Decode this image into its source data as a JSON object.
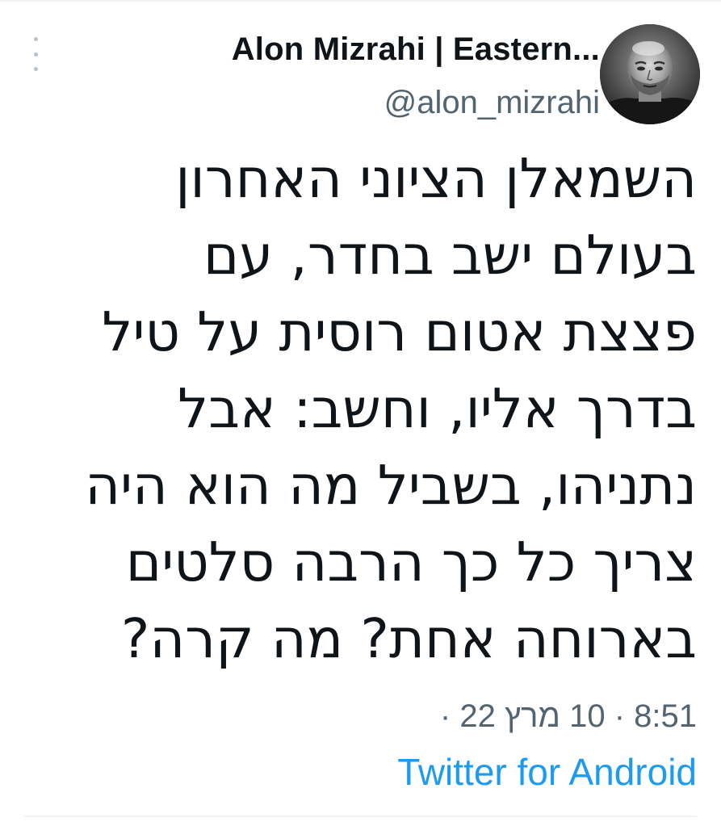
{
  "tweet": {
    "author": {
      "display_name": "Alon Mizrahi | Eastern...",
      "handle": "@alon_mizrahi",
      "avatar_icon": "profile-photo"
    },
    "text_lines": [
      "השמאלן הציוני האחרון",
      "בעולם ישב בחדר, עם",
      "פצצת אטום רוסית על טיל",
      "בדרך אליו, וחשב: אבל",
      "נתניהו, בשביל מה הוא היה",
      "צריך כל כך הרבה סלטים",
      "בארוחה אחת? מה קרה?"
    ],
    "timestamp": "8:51 · 10 מרץ 22 ·",
    "source": "Twitter for Android"
  },
  "colors": {
    "text_primary": "#0f1419",
    "text_secondary": "#536471",
    "link": "#1d9bf0",
    "divider": "#eff3f4"
  }
}
